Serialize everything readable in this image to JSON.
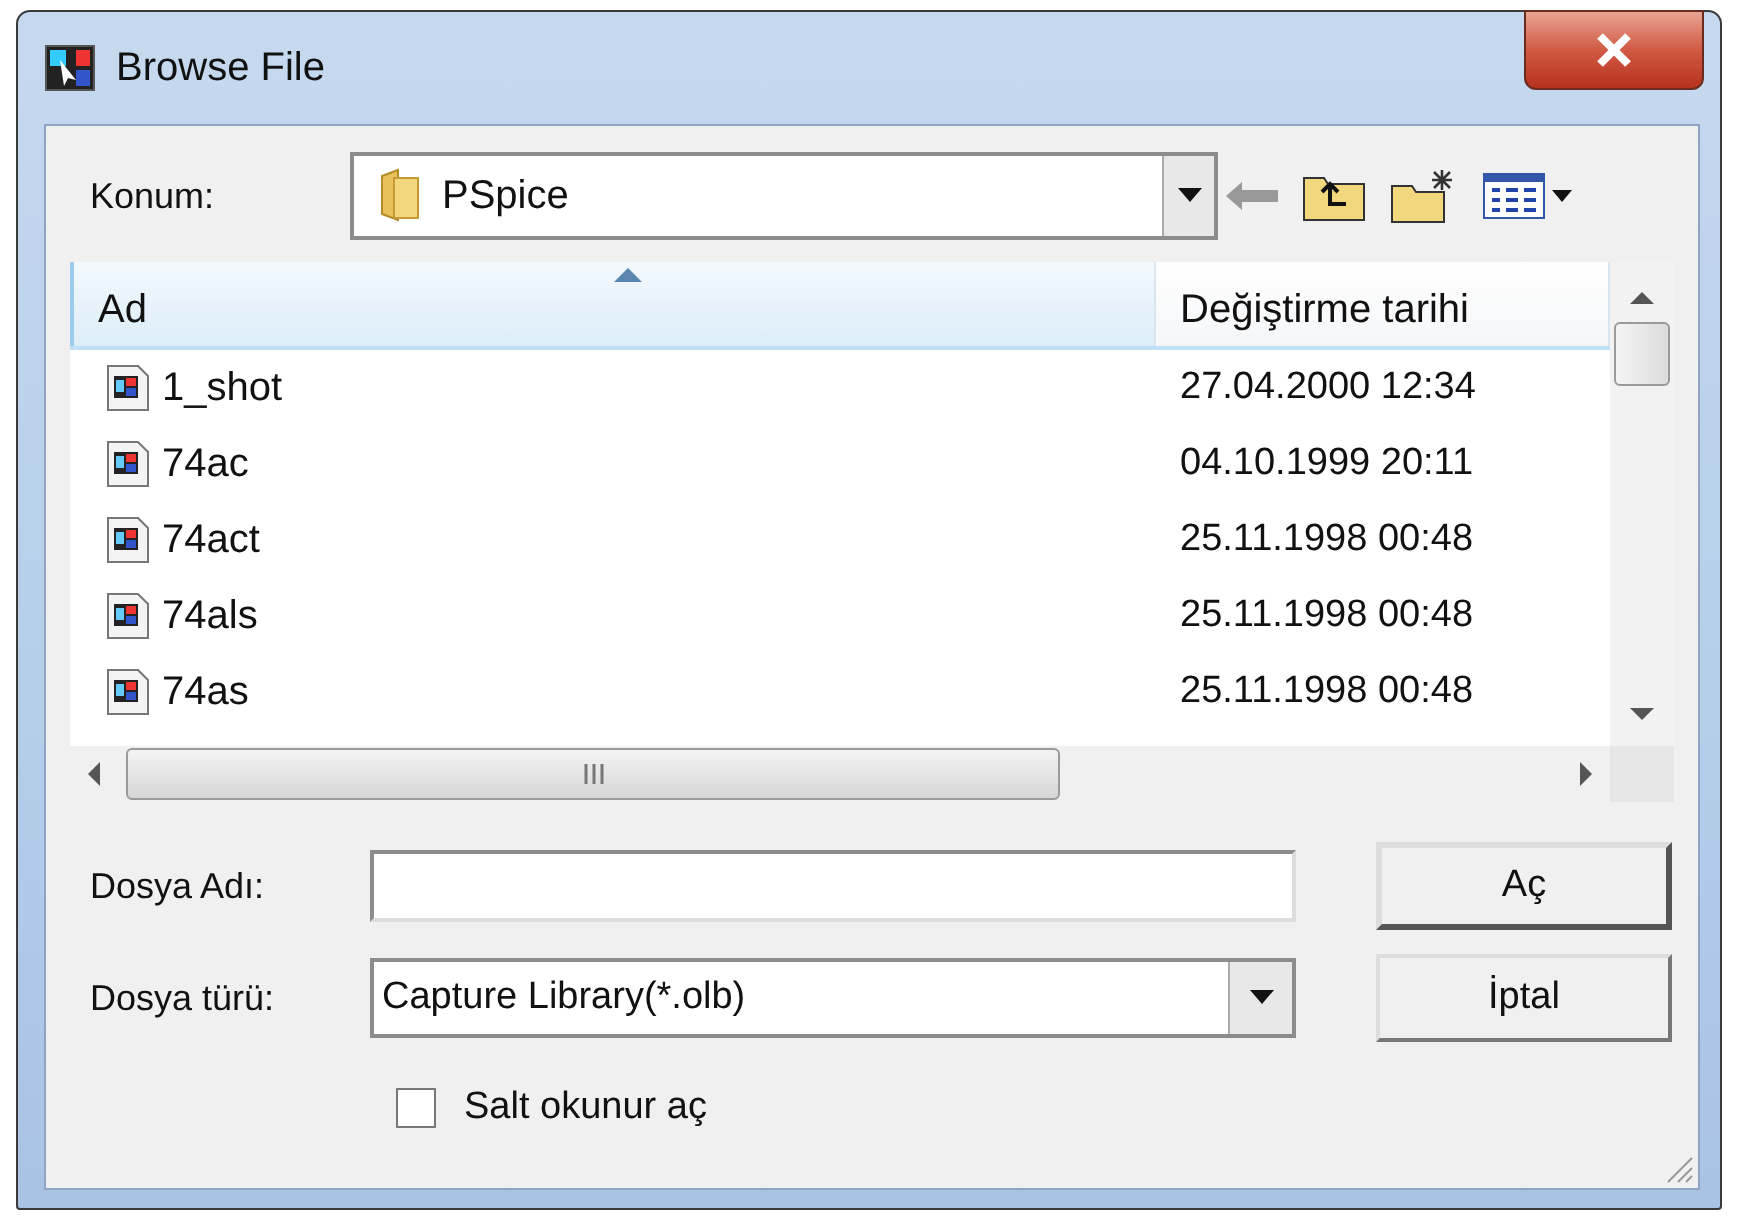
{
  "window": {
    "title": "Browse File"
  },
  "location": {
    "label": "Konum:",
    "value": "PSpice"
  },
  "list": {
    "columns": [
      {
        "label": "Ad",
        "sorted": true
      },
      {
        "label": "Değiştirme tarihi",
        "sorted": false
      }
    ],
    "rows": [
      {
        "name": "1_shot",
        "date": "27.04.2000 12:34"
      },
      {
        "name": "74ac",
        "date": "04.10.1999 20:11"
      },
      {
        "name": "74act",
        "date": "25.11.1998 00:48"
      },
      {
        "name": "74als",
        "date": "25.11.1998 00:48"
      },
      {
        "name": "74as",
        "date": "25.11.1998 00:48"
      }
    ]
  },
  "file_name": {
    "label": "Dosya Adı:"
  },
  "file_type": {
    "label": "Dosya türü:",
    "value": "Capture Library(*.olb)"
  },
  "buttons": [
    {
      "label": "Aç",
      "default": true
    },
    {
      "label": "İptal",
      "default": false
    }
  ],
  "read_only": {
    "label": "Salt okunur aç",
    "checked": false
  }
}
